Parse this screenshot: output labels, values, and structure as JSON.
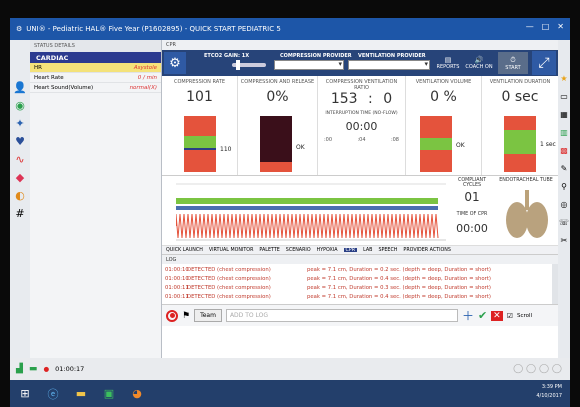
{
  "window": {
    "title": "UNI® - Pediatric HAL® Five Year (P1602895) - QUICK START PEDIATRIC 5",
    "controls": [
      "—",
      "□",
      "✕"
    ]
  },
  "status_panel": {
    "header": "STATUS DETAILS",
    "title": "CARDIAC",
    "rows": [
      {
        "label": "HR",
        "value": "Asystole"
      },
      {
        "label": "Heart Rate",
        "value": "0 / min"
      },
      {
        "label": "Heart Sound(Volume)",
        "value": "normal(X)"
      }
    ]
  },
  "cpr": {
    "tab_label": "CPR",
    "toolbar": {
      "etco2_label": "ETCO2 GAIN: 1X",
      "compression_provider": "COMPRESSION PROVIDER",
      "ventilation_provider": "VENTILATION PROVIDER",
      "reports": "REPORTS",
      "coach_on": "COACH ON",
      "start": "START"
    },
    "metrics": {
      "compression_rate": {
        "label": "COMPRESSION RATE",
        "value": "101",
        "note": "110"
      },
      "compression_release": {
        "label": "COMPRESSION AND RELEASE",
        "value": "0%",
        "note": "OK"
      },
      "compression_ventilation_ratio": {
        "label": "COMPRESSION VENTILATION RATIO",
        "value_left": "153",
        "sep": ":",
        "value_right": "0",
        "interruption_label": "INTERRUPTION TIME (NO-FLOW)",
        "interruption_value": "00:00",
        "ticks": [
          ":00",
          ":04",
          ":08"
        ]
      },
      "ventilation_volume": {
        "label": "VENTILATION VOLUME",
        "value": "0 %",
        "note": "OK"
      },
      "ventilation_duration": {
        "label": "VENTILATION DURATION",
        "value": "0 sec",
        "note": "1 sec"
      }
    },
    "compression_cycles_label": "COMPLIANT CYCLES",
    "compression_cycles_value": "01",
    "time_of_cpr_label": "TIME OF CPR",
    "time_of_cpr_value": "00:00",
    "endotracheal_label": "ENDOTRACHEAL TUBE",
    "tabs": [
      "QUICK LAUNCH",
      "VIRTUAL MONITOR",
      "PALETTE",
      "SCENARIO",
      "HYPOXIA",
      "CPR",
      "LAB",
      "SPEECH",
      "PROVIDER ACTIONS"
    ],
    "active_tab": "CPR",
    "log": {
      "header": "LOG",
      "rows": [
        {
          "time": "01:00:10",
          "desc": "DETECTED (chest compression)",
          "detail": "peak = 7.1 cm, Duration = 0.2 sec. (depth = deep, Duration = short)"
        },
        {
          "time": "01:00:10",
          "desc": "DETECTED (chest compression)",
          "detail": "peak = 7.1 cm, Duration = 0.4 sec. (depth = deep, Duration = short)"
        },
        {
          "time": "01:00:11",
          "desc": "DETECTED (chest compression)",
          "detail": "peak = 7.1 cm, Duration = 0.3 sec. (depth = deep, Duration = short)"
        },
        {
          "time": "01:00:11",
          "desc": "DETECTED (chest compression)",
          "detail": "peak = 7.1 cm, Duration = 0.4 sec. (depth = deep, Duration = short)"
        }
      ]
    },
    "team_label": "Team",
    "add_to_log_placeholder": "ADD TO LOG",
    "scroll_label": "Scroll"
  },
  "status_bar": {
    "timer": "01:00:17"
  },
  "clock": {
    "time": "3:39 PM",
    "date": "4/10/2017"
  }
}
